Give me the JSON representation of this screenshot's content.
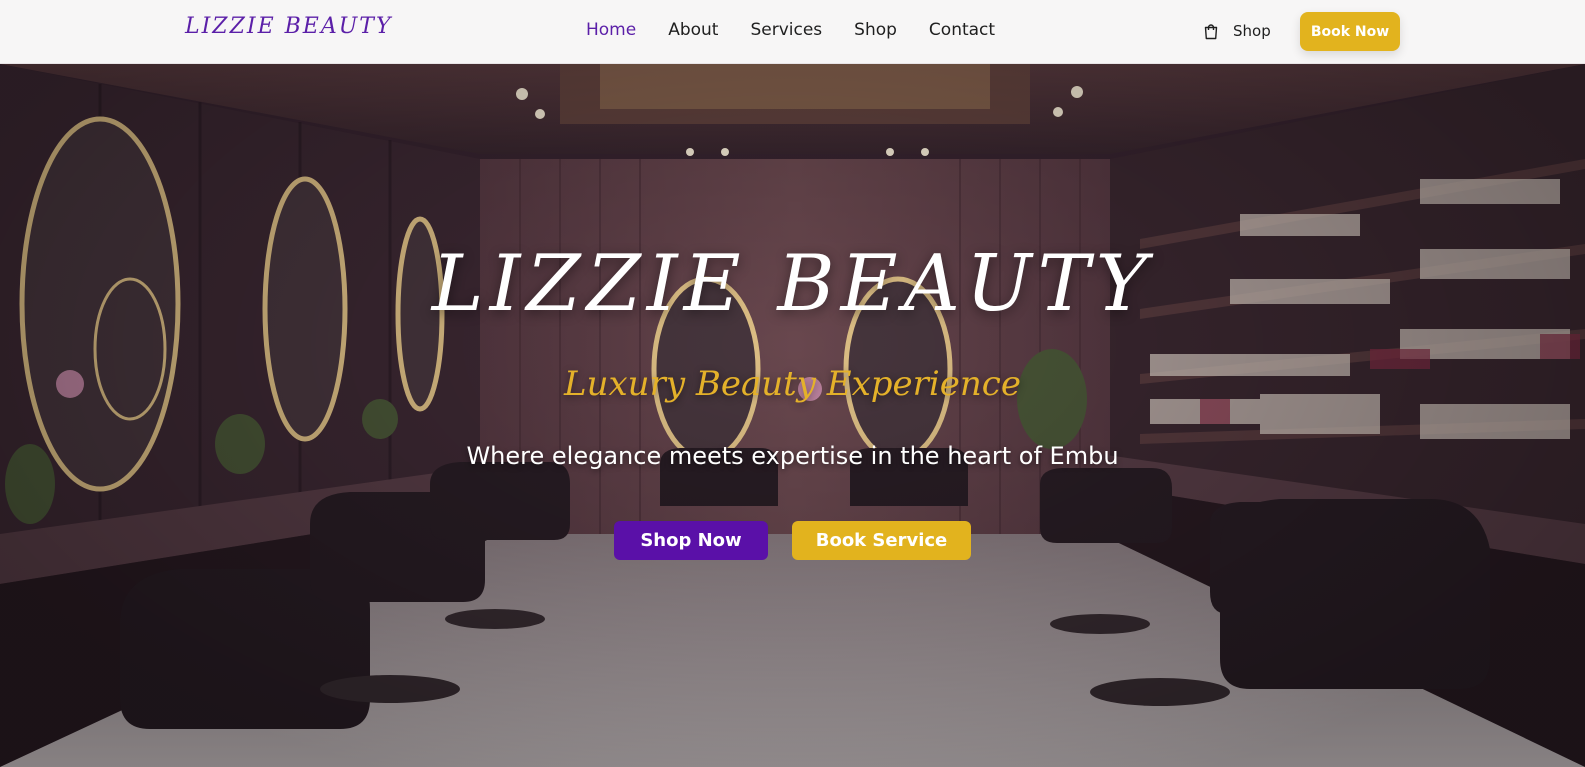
{
  "brand": {
    "logo": "LIZZIE BEAUTY"
  },
  "nav": {
    "links": [
      {
        "label": "Home",
        "active": true
      },
      {
        "label": "About",
        "active": false
      },
      {
        "label": "Services",
        "active": false
      },
      {
        "label": "Shop",
        "active": false
      },
      {
        "label": "Contact",
        "active": false
      }
    ],
    "shop_label": "Shop",
    "shop_icon": "shopping-bag-icon",
    "book_now_label": "Book Now"
  },
  "hero": {
    "title": "LIZZIE BEAUTY",
    "subtitle": "Luxury Beauty Experience",
    "tagline": "Where elegance meets expertise in the heart of Embu",
    "shop_now_label": "Shop Now",
    "book_service_label": "Book Service"
  },
  "colors": {
    "brand_purple": "#5a10a8",
    "accent_gold": "#e2b31e",
    "nav_background": "#f7f6f6",
    "nav_text": "#1f1f1f"
  }
}
